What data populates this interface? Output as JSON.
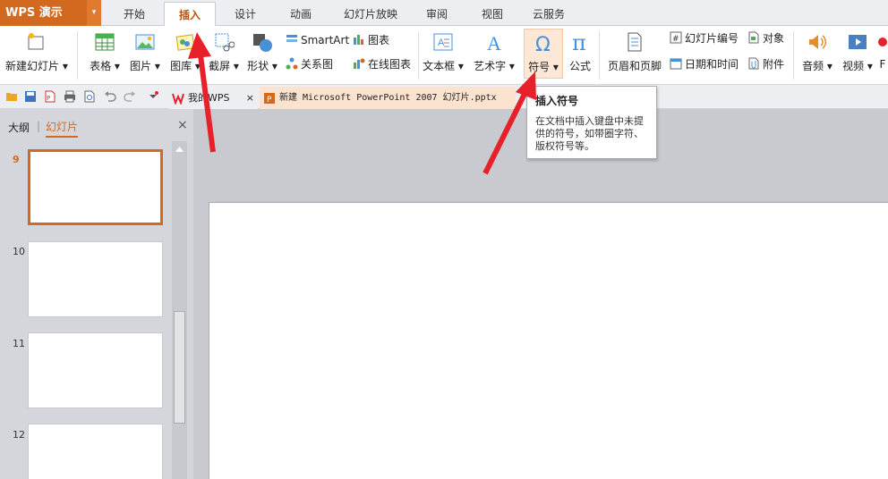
{
  "app": {
    "name": "WPS 演示",
    "menu_arrow": "▾"
  },
  "tabs": [
    "开始",
    "插入",
    "设计",
    "动画",
    "幻灯片放映",
    "审阅",
    "视图",
    "云服务"
  ],
  "ribbon": {
    "new_slide": "新建幻灯片 ▾",
    "table": "表格 ▾",
    "picture": "图片 ▾",
    "gallery": "图库 ▾",
    "screenshot": "截屏 ▾",
    "shape": "形状 ▾",
    "smartart": "SmartArt",
    "chart": "图表",
    "relation": "关系图",
    "online_chart": "在线图表",
    "textbox": "文本框 ▾",
    "wordart": "艺术字 ▾",
    "symbol": "符号 ▾",
    "formula": "公式",
    "header_footer": "页眉和页脚",
    "slide_number": "幻灯片编号",
    "object": "对象",
    "datetime": "日期和时间",
    "attachment": "附件",
    "audio": "音频 ▾",
    "video": "视频 ▾",
    "flash": "F"
  },
  "doc_tabs": {
    "home": "我的WPS",
    "file": "新建 Microsoft PowerPoint 2007 幻灯片.pptx",
    "close": "×"
  },
  "panel": {
    "outline": "大纲",
    "slides": "幻灯片",
    "close": "×",
    "slide_numbers": [
      "9",
      "10",
      "11",
      "12"
    ]
  },
  "tooltip": {
    "title": "插入符号",
    "desc": "在文档中插入键盘中未提供的符号，如带圈字符、版权符号等。"
  },
  "colors": {
    "accent": "#d2691e",
    "arrow": "#e8202a"
  }
}
